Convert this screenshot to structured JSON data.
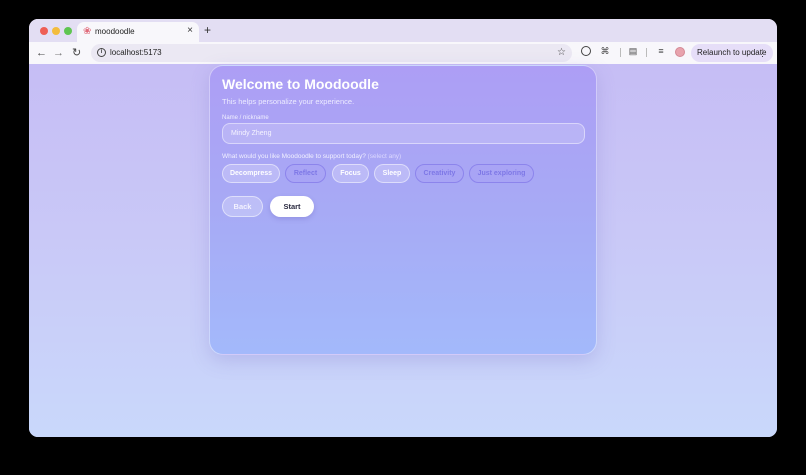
{
  "browser": {
    "tab_title": "moodoodle",
    "tab_close": "×",
    "new_tab": "+",
    "url": "localhost:5173",
    "relaunch_label": "Relaunch to update",
    "icons": {
      "back": "arrow-left-icon",
      "forward": "arrow-right-icon",
      "reload": "reload-icon",
      "site_info": "info-icon",
      "bookmark": "star-icon",
      "menu": "kebab-menu-icon"
    }
  },
  "onboarding": {
    "title": "Welcome to Moodoodle",
    "subtitle": "This helps personalize your experience.",
    "name_label": "Name / nickname",
    "name_value": "Mindy Zheng",
    "question": "What would you like Moodoodle to support today?",
    "question_hint": "(select any)",
    "options": [
      {
        "label": "Decompress",
        "selected": false
      },
      {
        "label": "Reflect",
        "selected": true
      },
      {
        "label": "Focus",
        "selected": false
      },
      {
        "label": "Sleep",
        "selected": false
      },
      {
        "label": "Creativity",
        "selected": true
      },
      {
        "label": "Just exploring",
        "selected": true
      }
    ],
    "back_label": "Back",
    "start_label": "Start"
  },
  "colors": {
    "page_top": "#c6bdf5",
    "page_bottom": "#c9d8fb",
    "card_top": "#ad9ef5",
    "card_bottom": "#a3b9fb",
    "selected_chip_text": "#7d77e6"
  }
}
